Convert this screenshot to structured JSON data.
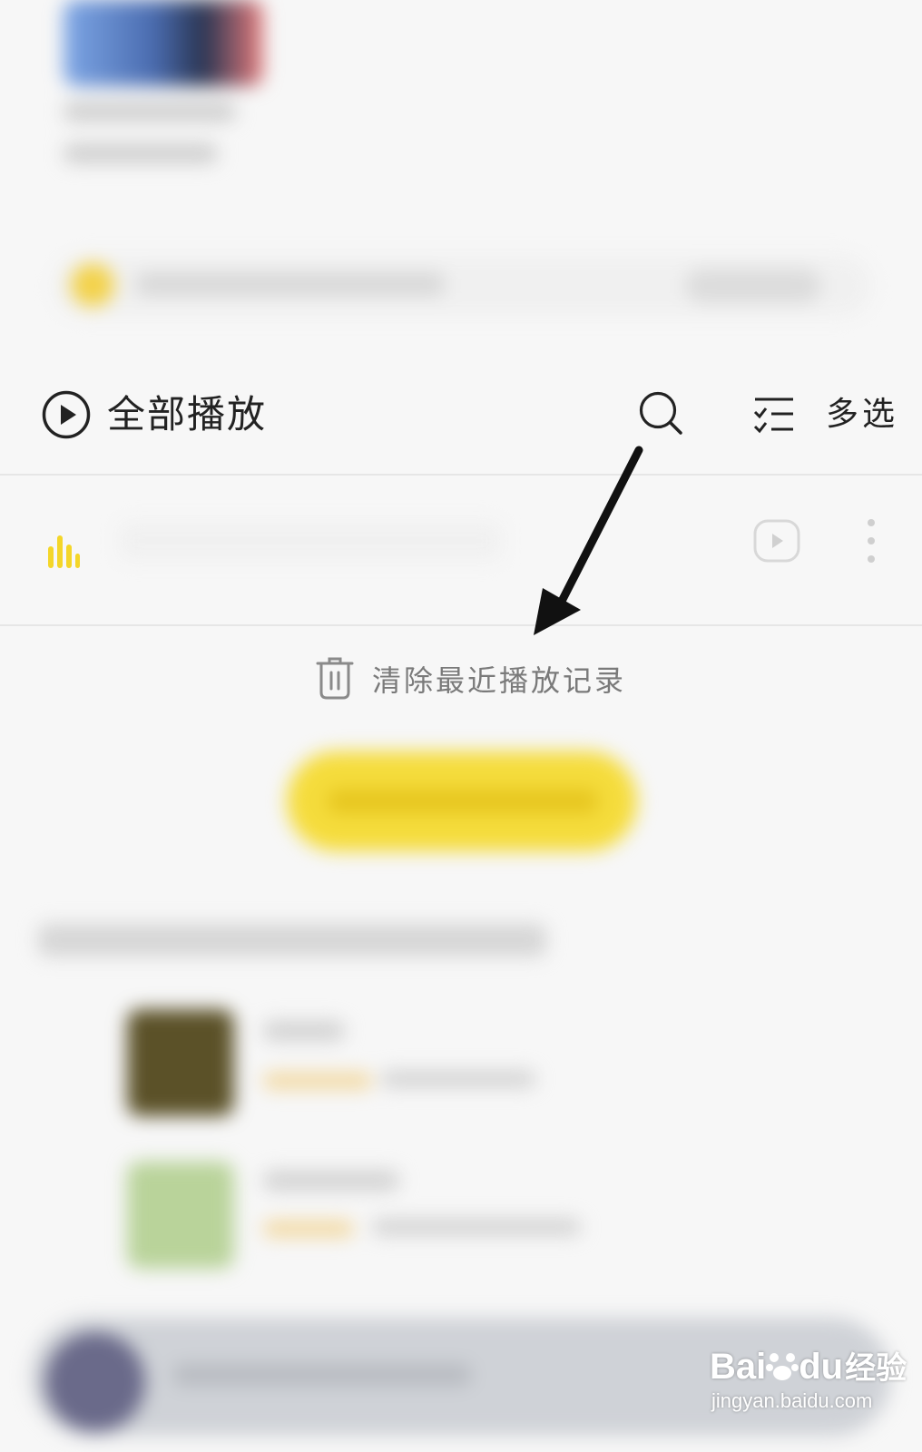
{
  "toolbar": {
    "play_all_label": "全部播放",
    "multi_select_label": "多选"
  },
  "clear_history": {
    "label": "清除最近播放记录"
  },
  "colors": {
    "accent_yellow": "#f5dc3c",
    "eq_yellow": "#f4d629",
    "text_gray": "#7a7a7a"
  },
  "icons": {
    "play_all": "play-circle-icon",
    "search": "search-icon",
    "multi_select": "checklist-icon",
    "now_playing": "equalizer-icon",
    "mv": "video-play-icon",
    "more": "more-vertical-icon",
    "clear": "trash-icon"
  },
  "watermark": {
    "brand": "Bai",
    "brand_suffix": "du",
    "cn": "经验",
    "url": "jingyan.baidu.com"
  }
}
